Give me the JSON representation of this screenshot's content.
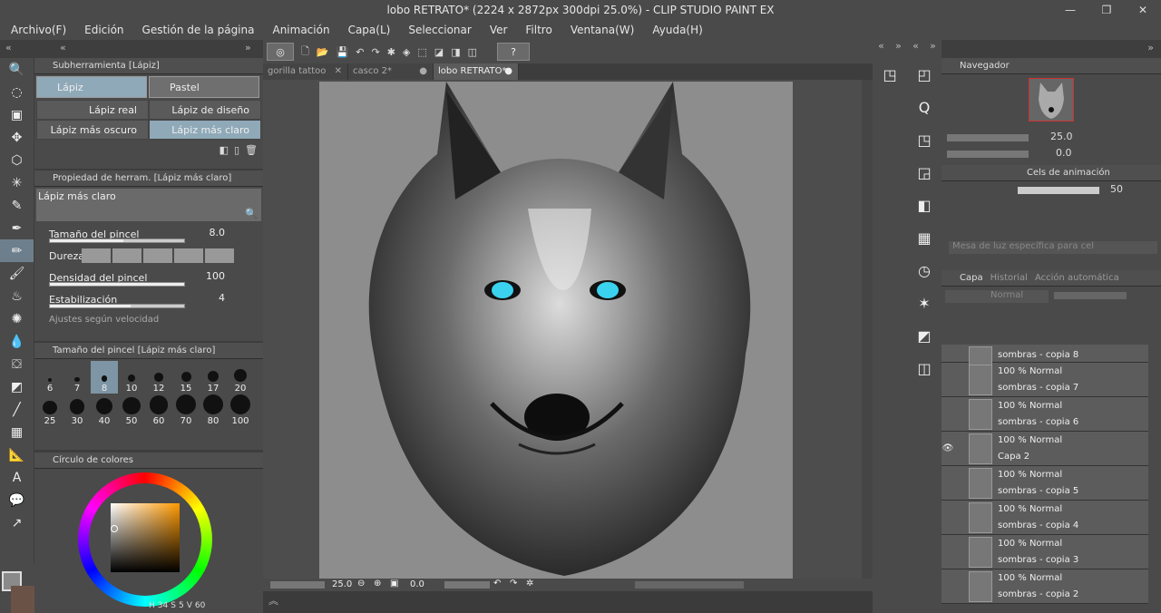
{
  "window": {
    "title": "lobo RETRATO* (2224 x 2872px 300dpi 25.0%)  - CLIP STUDIO PAINT EX",
    "minimize": "—",
    "maximize": "❐",
    "close": "✕"
  },
  "menu": [
    "Archivo(F)",
    "Edición",
    "Gestión de la página",
    "Animación",
    "Capa(L)",
    "Seleccionar",
    "Ver",
    "Filtro",
    "Ventana(W)",
    "Ayuda(H)"
  ],
  "subtool": {
    "header": "Subherramienta [Lápiz]",
    "tabs": [
      "Lápiz",
      "Pastel"
    ],
    "brushes": [
      [
        "Lápiz real",
        "Lápiz de diseño"
      ],
      [
        "Lápiz más oscuro",
        "Lápiz más claro"
      ]
    ]
  },
  "toolprop": {
    "header": "Propiedad de herram. [Lápiz más claro]",
    "preview_name": "Lápiz más claro",
    "rows": [
      {
        "label": "Tamaño del pincel",
        "value": "8.0",
        "fill": 0.55
      },
      {
        "label": "Dureza",
        "value": ""
      },
      {
        "label": "Densidad del pincel",
        "value": "100",
        "fill": 1.0
      },
      {
        "label": "Estabilización",
        "value": "4",
        "fill": 0.6
      }
    ],
    "footer": "Ajustes según velocidad"
  },
  "brushsize": {
    "header": "Tamaño del pincel [Lápiz más claro]",
    "sizes": [
      "6",
      "7",
      "8",
      "10",
      "12",
      "15",
      "17",
      "20",
      "25",
      "30",
      "40",
      "50",
      "60",
      "70",
      "80",
      "100"
    ],
    "selected": "8"
  },
  "colorwheel": {
    "header": "Círculo de colores",
    "h": "34",
    "s": "5",
    "v": "60",
    "h_label": "H",
    "s_label": "S",
    "v_label": "V"
  },
  "tabs": [
    {
      "label": "gorilla tattoo",
      "mark": "✕"
    },
    {
      "label": "casco 2*",
      "mark": "●"
    },
    {
      "label": "lobo RETRATO*",
      "mark": "●",
      "selected": true
    }
  ],
  "status": {
    "zoom": "25.0",
    "angle": "0.0"
  },
  "navigator": {
    "tabs": [
      "Navegador"
    ],
    "zoom": "25.0",
    "angle": "0.0"
  },
  "animation": {
    "header": "Cels de animación",
    "opacity": "50",
    "placeholder": "Mesa de luz específica para cel"
  },
  "layers": {
    "tabs": [
      "Capa",
      "Historial",
      "Acción automática"
    ],
    "blend": "Normal",
    "items": [
      {
        "mode": "",
        "name": "sombras - copia 8",
        "visible": false,
        "partial": true
      },
      {
        "mode": "100 % Normal",
        "name": "sombras - copia 7",
        "visible": false
      },
      {
        "mode": "100 % Normal",
        "name": "sombras - copia 6",
        "visible": false
      },
      {
        "mode": "100 % Normal",
        "name": "Capa 2",
        "visible": true
      },
      {
        "mode": "100 % Normal",
        "name": "sombras - copia 5",
        "visible": false
      },
      {
        "mode": "100 % Normal",
        "name": "sombras - copia 4",
        "visible": false
      },
      {
        "mode": "100 % Normal",
        "name": "sombras - copia 3",
        "visible": false
      },
      {
        "mode": "100 % Normal",
        "name": "sombras - copia 2",
        "visible": false
      }
    ]
  },
  "colors": {
    "accent": "#8fa9b8",
    "panel": "#4a4a4a",
    "main_color": "#8a8a8a",
    "sub_color": "#6b5247"
  }
}
